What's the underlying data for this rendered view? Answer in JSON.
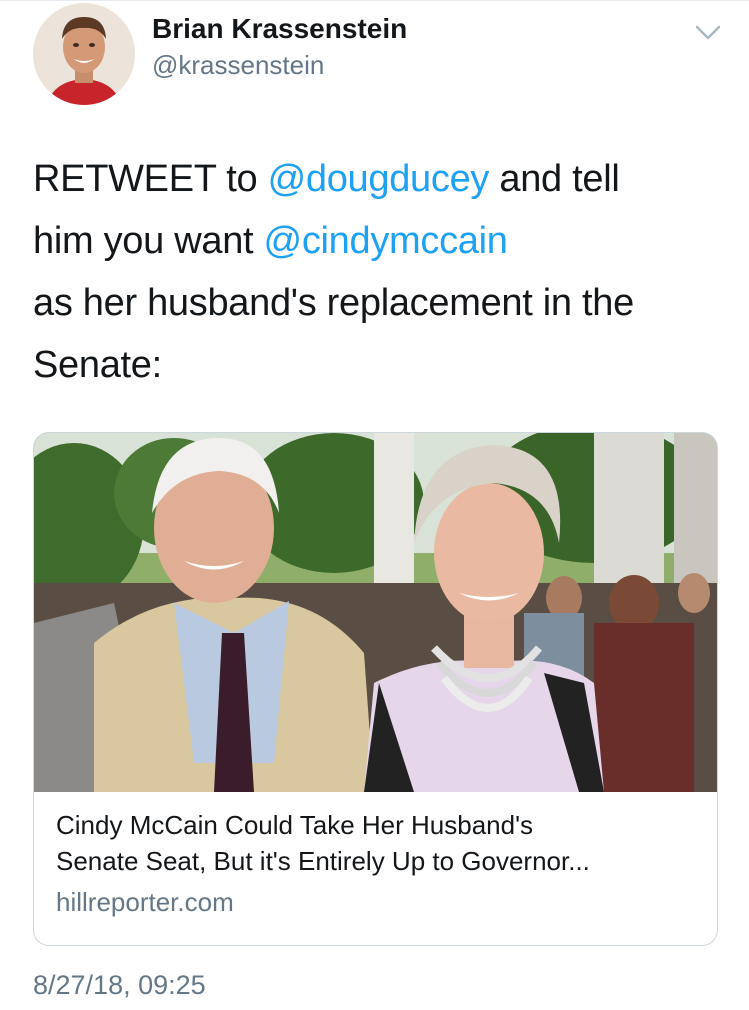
{
  "tweet": {
    "author": {
      "display_name": "Brian Krassenstein",
      "handle": "@krassenstein"
    },
    "text": {
      "line1_pre": "RETWEET to ",
      "line1_mention": "@dougducey",
      "line1_post": " and tell",
      "line2_pre": "him you want ",
      "line2_mention": "@cindymccain",
      "line3": "as her husband's replacement in the",
      "line4": "Senate:"
    },
    "card": {
      "title_line1": "Cindy McCain Could Take Her Husband's",
      "title_line2": "Senate Seat, But it's Entirely Up to Governor...",
      "domain": "hillreporter.com"
    },
    "timestamp": "8/27/18, 09:25"
  },
  "colors": {
    "text": "#14171a",
    "secondary": "#657786",
    "link": "#1da1f2",
    "border": "#ccd6dd"
  },
  "icons": {
    "menu": "chevron-down-icon"
  }
}
